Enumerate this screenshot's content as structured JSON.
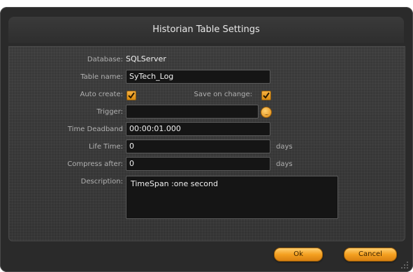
{
  "dialog": {
    "title": "Historian Table Settings",
    "database_label": "Database:",
    "database_value": "SQLServer",
    "table_name_label": "Table name:",
    "table_name_value": "SyTech_Log",
    "auto_create_label": "Auto create:",
    "auto_create_checked": true,
    "save_on_change_label": "Save on change:",
    "save_on_change_checked": true,
    "trigger_label": "Trigger:",
    "trigger_value": "",
    "time_deadband_label": "Time Deadband",
    "time_deadband_value": "00:00:01.000",
    "life_time_label": "Life Time:",
    "life_time_value": "0",
    "life_time_unit": "days",
    "compress_after_label": "Compress after:",
    "compress_after_value": "0",
    "compress_after_unit": "days",
    "description_label": "Description:",
    "description_value": "TimeSpan :one second",
    "ok_label": "Ok",
    "cancel_label": "Cancel"
  },
  "colors": {
    "accent": "#f4a020",
    "background": "#2a2a2a"
  },
  "icons": [
    "checkmark-icon",
    "browse-icon",
    "resize-grip-icon"
  ]
}
